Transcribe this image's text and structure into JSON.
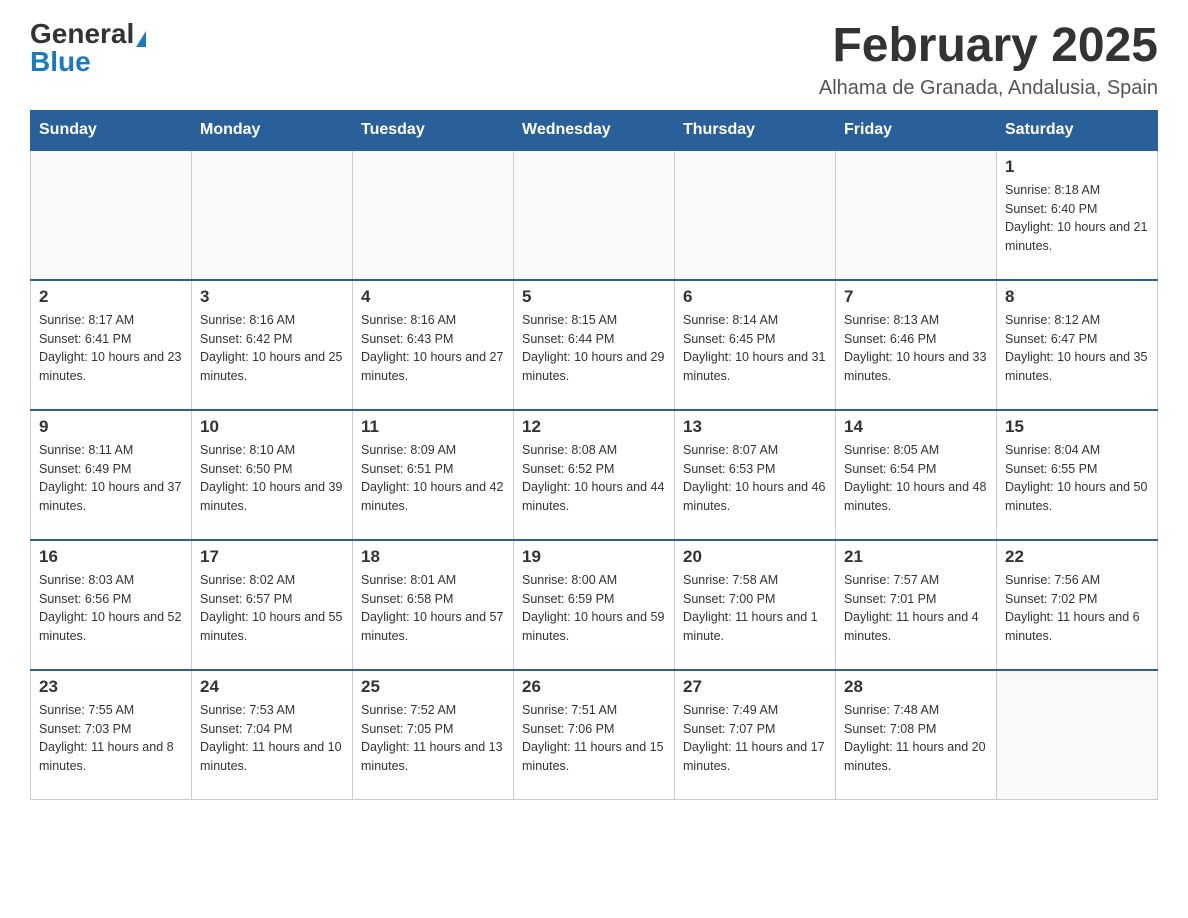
{
  "header": {
    "logo_general": "General",
    "logo_blue": "Blue",
    "month_title": "February 2025",
    "location": "Alhama de Granada, Andalusia, Spain"
  },
  "days_of_week": [
    "Sunday",
    "Monday",
    "Tuesday",
    "Wednesday",
    "Thursday",
    "Friday",
    "Saturday"
  ],
  "weeks": [
    [
      {
        "day": "",
        "info": ""
      },
      {
        "day": "",
        "info": ""
      },
      {
        "day": "",
        "info": ""
      },
      {
        "day": "",
        "info": ""
      },
      {
        "day": "",
        "info": ""
      },
      {
        "day": "",
        "info": ""
      },
      {
        "day": "1",
        "info": "Sunrise: 8:18 AM\nSunset: 6:40 PM\nDaylight: 10 hours and 21 minutes."
      }
    ],
    [
      {
        "day": "2",
        "info": "Sunrise: 8:17 AM\nSunset: 6:41 PM\nDaylight: 10 hours and 23 minutes."
      },
      {
        "day": "3",
        "info": "Sunrise: 8:16 AM\nSunset: 6:42 PM\nDaylight: 10 hours and 25 minutes."
      },
      {
        "day": "4",
        "info": "Sunrise: 8:16 AM\nSunset: 6:43 PM\nDaylight: 10 hours and 27 minutes."
      },
      {
        "day": "5",
        "info": "Sunrise: 8:15 AM\nSunset: 6:44 PM\nDaylight: 10 hours and 29 minutes."
      },
      {
        "day": "6",
        "info": "Sunrise: 8:14 AM\nSunset: 6:45 PM\nDaylight: 10 hours and 31 minutes."
      },
      {
        "day": "7",
        "info": "Sunrise: 8:13 AM\nSunset: 6:46 PM\nDaylight: 10 hours and 33 minutes."
      },
      {
        "day": "8",
        "info": "Sunrise: 8:12 AM\nSunset: 6:47 PM\nDaylight: 10 hours and 35 minutes."
      }
    ],
    [
      {
        "day": "9",
        "info": "Sunrise: 8:11 AM\nSunset: 6:49 PM\nDaylight: 10 hours and 37 minutes."
      },
      {
        "day": "10",
        "info": "Sunrise: 8:10 AM\nSunset: 6:50 PM\nDaylight: 10 hours and 39 minutes."
      },
      {
        "day": "11",
        "info": "Sunrise: 8:09 AM\nSunset: 6:51 PM\nDaylight: 10 hours and 42 minutes."
      },
      {
        "day": "12",
        "info": "Sunrise: 8:08 AM\nSunset: 6:52 PM\nDaylight: 10 hours and 44 minutes."
      },
      {
        "day": "13",
        "info": "Sunrise: 8:07 AM\nSunset: 6:53 PM\nDaylight: 10 hours and 46 minutes."
      },
      {
        "day": "14",
        "info": "Sunrise: 8:05 AM\nSunset: 6:54 PM\nDaylight: 10 hours and 48 minutes."
      },
      {
        "day": "15",
        "info": "Sunrise: 8:04 AM\nSunset: 6:55 PM\nDaylight: 10 hours and 50 minutes."
      }
    ],
    [
      {
        "day": "16",
        "info": "Sunrise: 8:03 AM\nSunset: 6:56 PM\nDaylight: 10 hours and 52 minutes."
      },
      {
        "day": "17",
        "info": "Sunrise: 8:02 AM\nSunset: 6:57 PM\nDaylight: 10 hours and 55 minutes."
      },
      {
        "day": "18",
        "info": "Sunrise: 8:01 AM\nSunset: 6:58 PM\nDaylight: 10 hours and 57 minutes."
      },
      {
        "day": "19",
        "info": "Sunrise: 8:00 AM\nSunset: 6:59 PM\nDaylight: 10 hours and 59 minutes."
      },
      {
        "day": "20",
        "info": "Sunrise: 7:58 AM\nSunset: 7:00 PM\nDaylight: 11 hours and 1 minute."
      },
      {
        "day": "21",
        "info": "Sunrise: 7:57 AM\nSunset: 7:01 PM\nDaylight: 11 hours and 4 minutes."
      },
      {
        "day": "22",
        "info": "Sunrise: 7:56 AM\nSunset: 7:02 PM\nDaylight: 11 hours and 6 minutes."
      }
    ],
    [
      {
        "day": "23",
        "info": "Sunrise: 7:55 AM\nSunset: 7:03 PM\nDaylight: 11 hours and 8 minutes."
      },
      {
        "day": "24",
        "info": "Sunrise: 7:53 AM\nSunset: 7:04 PM\nDaylight: 11 hours and 10 minutes."
      },
      {
        "day": "25",
        "info": "Sunrise: 7:52 AM\nSunset: 7:05 PM\nDaylight: 11 hours and 13 minutes."
      },
      {
        "day": "26",
        "info": "Sunrise: 7:51 AM\nSunset: 7:06 PM\nDaylight: 11 hours and 15 minutes."
      },
      {
        "day": "27",
        "info": "Sunrise: 7:49 AM\nSunset: 7:07 PM\nDaylight: 11 hours and 17 minutes."
      },
      {
        "day": "28",
        "info": "Sunrise: 7:48 AM\nSunset: 7:08 PM\nDaylight: 11 hours and 20 minutes."
      },
      {
        "day": "",
        "info": ""
      }
    ]
  ]
}
